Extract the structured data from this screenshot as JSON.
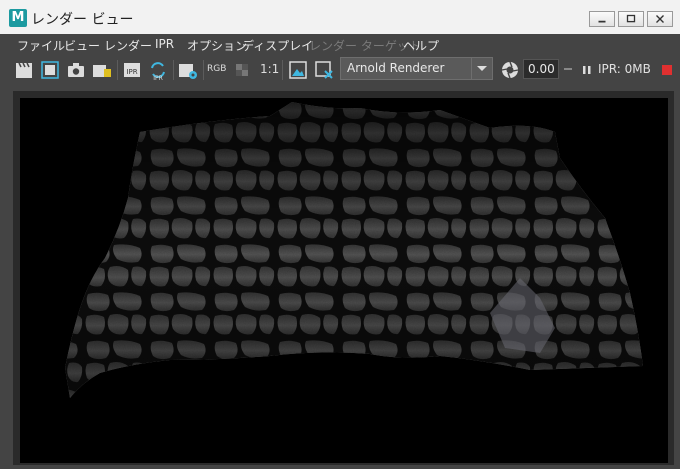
{
  "window": {
    "title": "レンダー ビュー",
    "app_icon_letter": "M"
  },
  "menu": [
    {
      "label": "ファイル",
      "enabled": true
    },
    {
      "label": "ビュー",
      "enabled": true
    },
    {
      "label": "レンダー",
      "enabled": true
    },
    {
      "label": "IPR",
      "enabled": true
    },
    {
      "label": "オプション",
      "enabled": true
    },
    {
      "label": "ディスプレイ",
      "enabled": true
    },
    {
      "label": "レンダー ターゲット",
      "enabled": false
    },
    {
      "label": "ヘルプ",
      "enabled": true
    }
  ],
  "toolbar": {
    "rgb_label": "RGB",
    "ratio_label": "1:1",
    "renderer_value": "Arnold Renderer",
    "exposure_value": "0.00",
    "ipr_status": "IPR: 0MB",
    "stop_color": "#e03030"
  }
}
